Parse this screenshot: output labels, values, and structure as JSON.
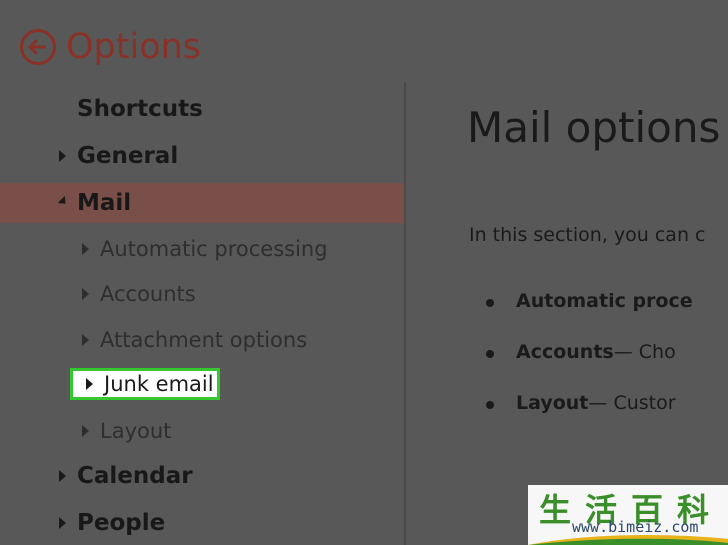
{
  "header": {
    "title": "Options"
  },
  "sidebar": {
    "items": [
      {
        "label": "Shortcuts"
      },
      {
        "label": "General"
      },
      {
        "label": "Mail"
      },
      {
        "label": "Automatic processing"
      },
      {
        "label": "Accounts"
      },
      {
        "label": "Attachment options"
      },
      {
        "label": "Junk email"
      },
      {
        "label": "Layout"
      },
      {
        "label": "Calendar"
      },
      {
        "label": "People"
      }
    ]
  },
  "content": {
    "title": "Mail options",
    "intro": "In this section, you can c",
    "bullets": [
      {
        "bold": "Automatic proce",
        "rest": ""
      },
      {
        "bold": "Accounts",
        "rest": " — Cho"
      },
      {
        "bold": "Layout",
        "rest": " — Custor"
      }
    ]
  },
  "watermark": {
    "chars": [
      "生",
      "活",
      "百",
      "科"
    ],
    "url": "www.bimeiz.com"
  },
  "colors": {
    "accent": "#8a3127",
    "selected_bg": "#7a4e49",
    "highlight_border": "#35c82f",
    "background": "#585858"
  }
}
